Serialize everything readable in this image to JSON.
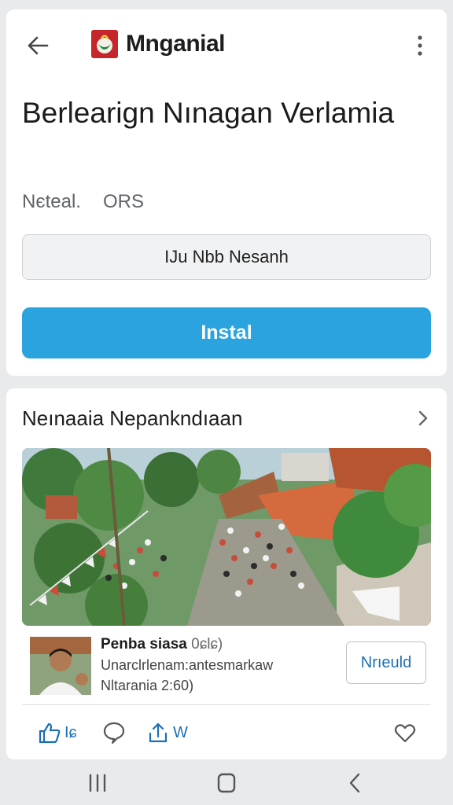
{
  "header": {
    "app_title": "Mnganial"
  },
  "app": {
    "name": "Berlearign Nınagan Verlamia",
    "meta_left": "Nєteal.",
    "meta_right": "ORS",
    "secondary_button": "IJu Nbb Nesanh",
    "install_button": "Instal"
  },
  "section": {
    "title": "Neınaaia Nepankndıaan"
  },
  "post": {
    "author": "Penba siasa",
    "author_meta": "0ɕlɕ)",
    "description": "Unarclrlenam:antesmarkaw",
    "time": "Nltarania 2:60)",
    "follow_button": "Nrıeuld"
  },
  "actions": {
    "like_count": "Iɕ",
    "share_label": "W"
  },
  "colors": {
    "accent": "#2aa3df",
    "link": "#1d6fb4",
    "background": "#e9eaec"
  },
  "icons": {
    "back": "arrow-left-icon",
    "more": "more-vertical-icon",
    "chevron": "chevron-right-icon",
    "like": "thumbs-up-icon",
    "comment": "comment-icon",
    "share": "share-icon",
    "heart": "heart-icon",
    "nav_recents": "recents-icon",
    "nav_home": "home-icon",
    "nav_back": "nav-back-icon"
  }
}
